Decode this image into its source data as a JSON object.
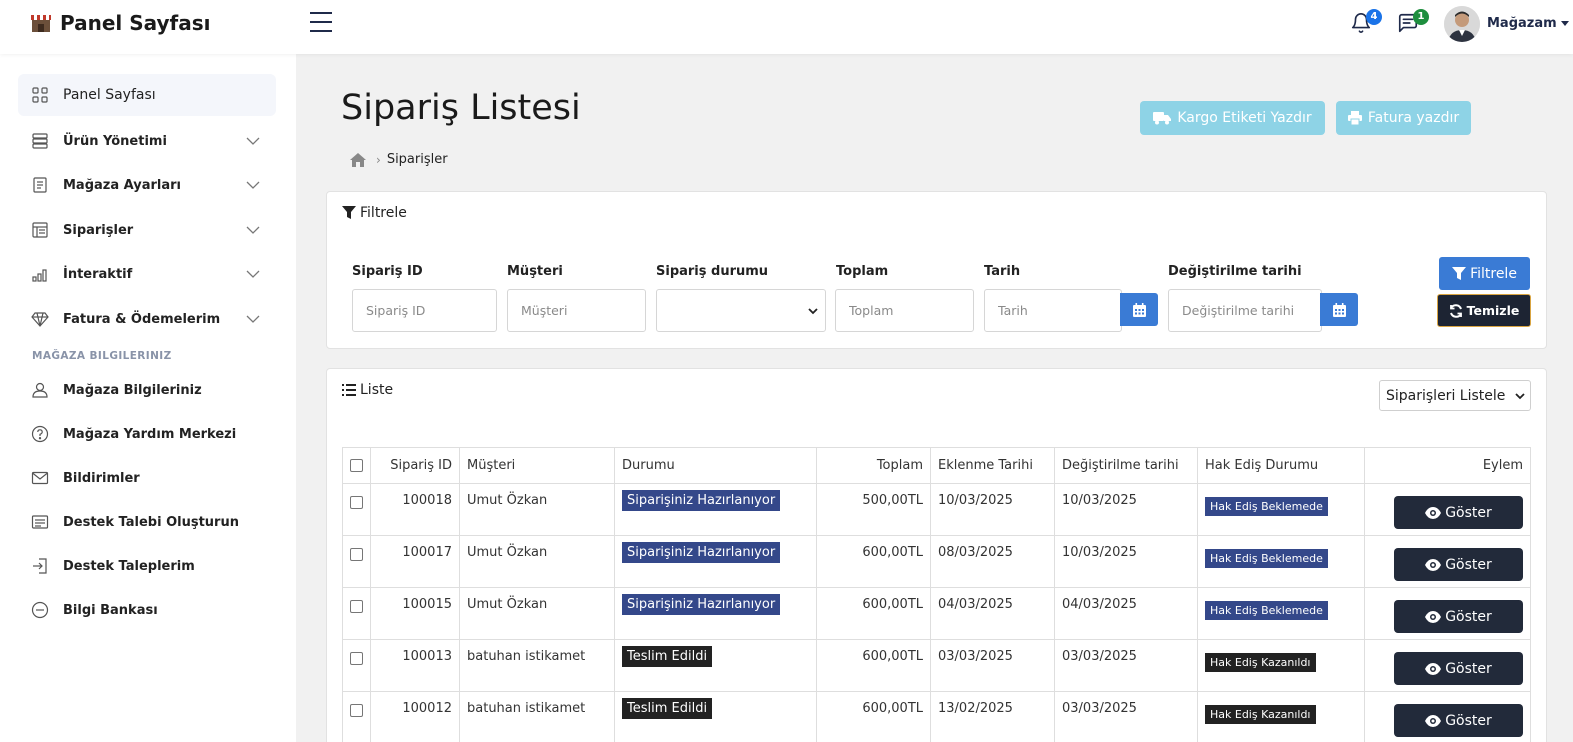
{
  "app": {
    "title": "Panel Sayfası"
  },
  "topbar": {
    "notifications_count": "4",
    "messages_count": "1",
    "user_label": "Mağazam",
    "colors": {
      "notify_badge": "#1a73e8",
      "message_badge": "#1e8e3e"
    }
  },
  "sidebar": {
    "items": [
      {
        "label": "Panel Sayfası",
        "icon": "grid-icon",
        "active": true
      },
      {
        "label": "Ürün Yönetimi",
        "icon": "server-icon",
        "expandable": true
      },
      {
        "label": "Mağaza Ayarları",
        "icon": "document-icon",
        "expandable": true
      },
      {
        "label": "Siparişler",
        "icon": "table-icon",
        "expandable": true
      },
      {
        "label": "İnteraktif",
        "icon": "bar-chart-icon",
        "expandable": true
      },
      {
        "label": "Fatura & Ödemelerim",
        "icon": "diamond-icon",
        "expandable": true
      }
    ],
    "section_title": "MAĞAZA BILGILERINIZ",
    "section_items": [
      {
        "label": "Mağaza Bilgileriniz",
        "icon": "user-icon"
      },
      {
        "label": "Mağaza Yardım Merkezi",
        "icon": "help-circle-icon"
      },
      {
        "label": "Bildirimler",
        "icon": "mail-icon"
      },
      {
        "label": "Destek Talebi Oluşturun",
        "icon": "list-icon"
      },
      {
        "label": "Destek Taleplerim",
        "icon": "login-icon"
      },
      {
        "label": "Bilgi Bankası",
        "icon": "minus-circle-icon"
      }
    ]
  },
  "page": {
    "title": "Sipariş Listesi",
    "actions": {
      "cargo_label": "Kargo Etiketi Yazdır",
      "invoice_label": "Fatura yazdır"
    },
    "breadcrumb": {
      "current": "Siparişler"
    }
  },
  "filter": {
    "title": "Filtrele",
    "fields": {
      "order_id": {
        "label": "Sipariş ID",
        "placeholder": "Sipariş ID"
      },
      "customer": {
        "label": "Müşteri",
        "placeholder": "Müşteri"
      },
      "status": {
        "label": "Sipariş durumu",
        "value": ""
      },
      "total": {
        "label": "Toplam",
        "placeholder": "Toplam"
      },
      "date": {
        "label": "Tarih",
        "placeholder": "Tarih"
      },
      "modified": {
        "label": "Değiştirilme tarihi",
        "placeholder": "Değiştirilme tarihi"
      }
    },
    "filter_button": "Filtrele",
    "clear_button": "Temizle"
  },
  "list": {
    "title": "Liste",
    "select_value": "Siparişleri Listele",
    "columns": [
      "Sipariş ID",
      "Müşteri",
      "Durumu",
      "Toplam",
      "Eklenme Tarihi",
      "Değiştirilme tarihi",
      "Hak Ediş Durumu",
      "Eylem"
    ],
    "action_label": "Göster",
    "colors": {
      "preparing": "#34488a",
      "delivered": "#222222",
      "pending": "#34488a",
      "earned": "#222222"
    },
    "rows": [
      {
        "id": "100018",
        "customer": "Umut Özkan",
        "status": "Siparişiniz Hazırlanıyor",
        "status_kind": "preparing",
        "total": "500,00TL",
        "created": "10/03/2025",
        "modified": "10/03/2025",
        "hak": "Hak Ediş Beklemede",
        "hak_kind": "pending"
      },
      {
        "id": "100017",
        "customer": "Umut Özkan",
        "status": "Siparişiniz Hazırlanıyor",
        "status_kind": "preparing",
        "total": "600,00TL",
        "created": "08/03/2025",
        "modified": "10/03/2025",
        "hak": "Hak Ediş Beklemede",
        "hak_kind": "pending"
      },
      {
        "id": "100015",
        "customer": "Umut Özkan",
        "status": "Siparişiniz Hazırlanıyor",
        "status_kind": "preparing",
        "total": "600,00TL",
        "created": "04/03/2025",
        "modified": "04/03/2025",
        "hak": "Hak Ediş Beklemede",
        "hak_kind": "pending"
      },
      {
        "id": "100013",
        "customer": "batuhan istikamet",
        "status": "Teslim Edildi",
        "status_kind": "delivered",
        "total": "600,00TL",
        "created": "03/03/2025",
        "modified": "03/03/2025",
        "hak": "Hak Ediş Kazanıldı",
        "hak_kind": "earned"
      },
      {
        "id": "100012",
        "customer": "batuhan istikamet",
        "status": "Teslim Edildi",
        "status_kind": "delivered",
        "total": "600,00TL",
        "created": "13/02/2025",
        "modified": "03/03/2025",
        "hak": "Hak Ediş Kazanıldı",
        "hak_kind": "earned"
      }
    ]
  }
}
